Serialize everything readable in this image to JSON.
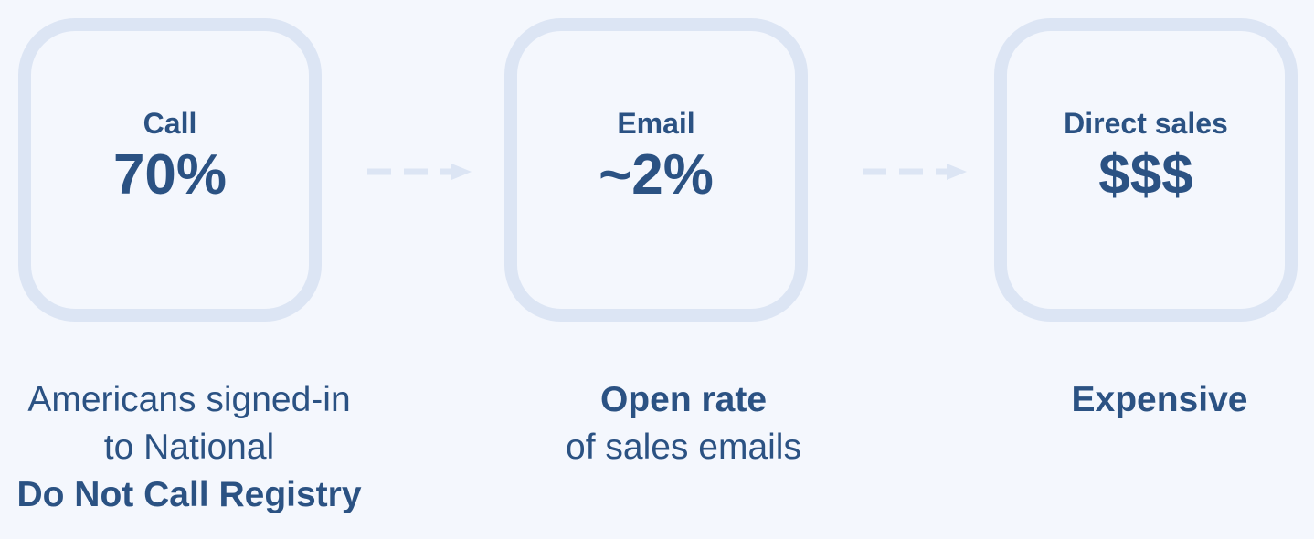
{
  "steps": [
    {
      "label": "Call",
      "value": "70%",
      "caption": {
        "line1": "Americans signed-in",
        "line2": "to  National",
        "line3": "Do Not Call Registry"
      }
    },
    {
      "label": "Email",
      "value": "~2%",
      "caption": {
        "line1": "Open rate",
        "line2": "of sales emails"
      }
    },
    {
      "label": "Direct sales",
      "value": "$$$",
      "caption": {
        "line1": "Expensive"
      }
    }
  ],
  "colors": {
    "background": "#f4f7fd",
    "card_border": "#dce5f4",
    "text": "#2b5283"
  }
}
